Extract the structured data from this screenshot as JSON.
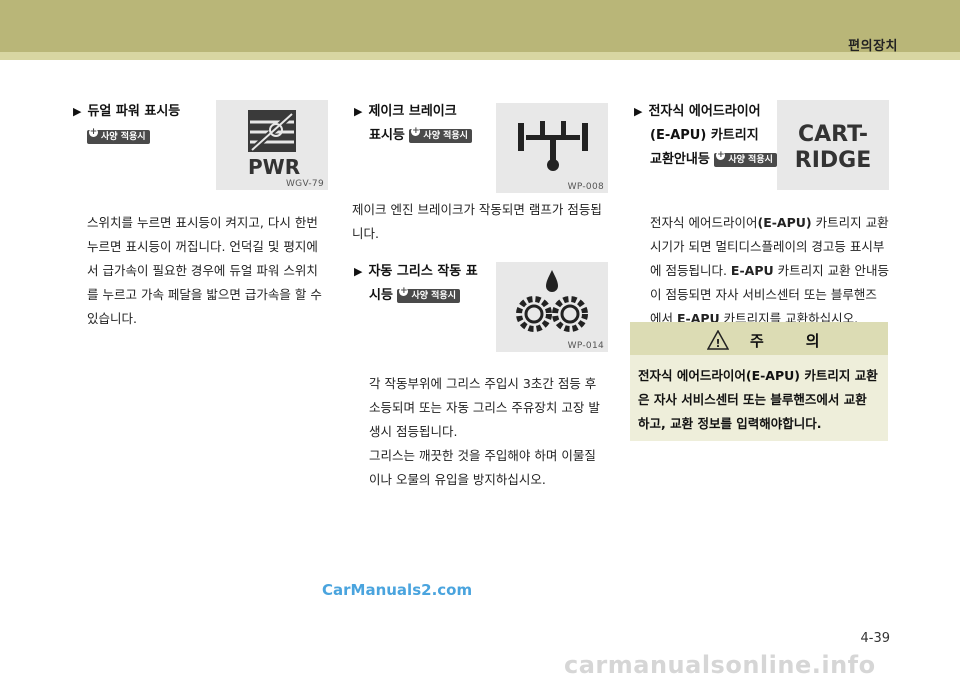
{
  "header": {
    "title": "편의장치"
  },
  "badge_label": "사양 적용시",
  "sections": {
    "dual_power": {
      "title": "듀얼 파워 표시등",
      "image_text": "PWR",
      "image_code": "WGV-79",
      "body": [
        "스위치를 누르면 표시등이 켜지고, 다시 한번",
        "누르면 표시등이 꺼집니다. 언덕길 및 평지에",
        "서 급가속이 필요한 경우에 듀얼 파워 스위치",
        "를 누르고 가속 페달을 밟으면 급가속을 할 수",
        "있습니다."
      ]
    },
    "engine_brake": {
      "title_line1": "제이크 브레이크",
      "title_line2": "표시등",
      "image_code": "WP-008",
      "body": [
        "제이크 엔진 브레이크가 작동되면 램프가 점등됩",
        "니다."
      ]
    },
    "auto_grease": {
      "title_line1": "자동 그리스 작동 표",
      "title_line2": "시등",
      "image_code": "WP-014",
      "body": [
        "각 작동부위에 그리스 주입시 3초간 점등 후",
        "소등되며 또는 자동 그리스 주유장치 고장 발",
        "생시 점등됩니다.",
        "그리스는 깨끗한 것을 주입해야 하며 이물질",
        "이나 오물의 유입을 방지하십시오."
      ]
    },
    "eapu": {
      "title_line1": "전자식 에어드라이어",
      "title_line2": "(E-APU) 카트리지",
      "title_line3": "교환안내등",
      "image_text_line1": "CART-",
      "image_text_line2": "RIDGE",
      "body_l1a": "전자식 에어드라이어",
      "body_l1b": "(E-APU)",
      "body_l1c": " 카트리지 교환",
      "body_l2": "시기가 되면 멀티디스플레이의 경고등 표시부",
      "body_l3a": "에 점등됩니다. ",
      "body_l3b": "E-APU",
      "body_l3c": " 카트리지 교환 안내등",
      "body_l4": "이 점등되면 자사 서비스센터 또는 블루핸즈",
      "body_l5a": "에서 ",
      "body_l5b": "E-APU",
      "body_l5c": " 카트리지를 교환하십시오."
    }
  },
  "caution": {
    "title": "주의",
    "lines": [
      "전자식 에어드라이어(E-APU) 카트리지 교환",
      "은 자사 서비스센터 또는 블루핸즈에서 교환",
      "하고, 교환 정보를 입력해야합니다."
    ]
  },
  "watermark": "CarManuals2.com",
  "page_number": "4-39",
  "footer_watermark": "carmanualsonline.info"
}
